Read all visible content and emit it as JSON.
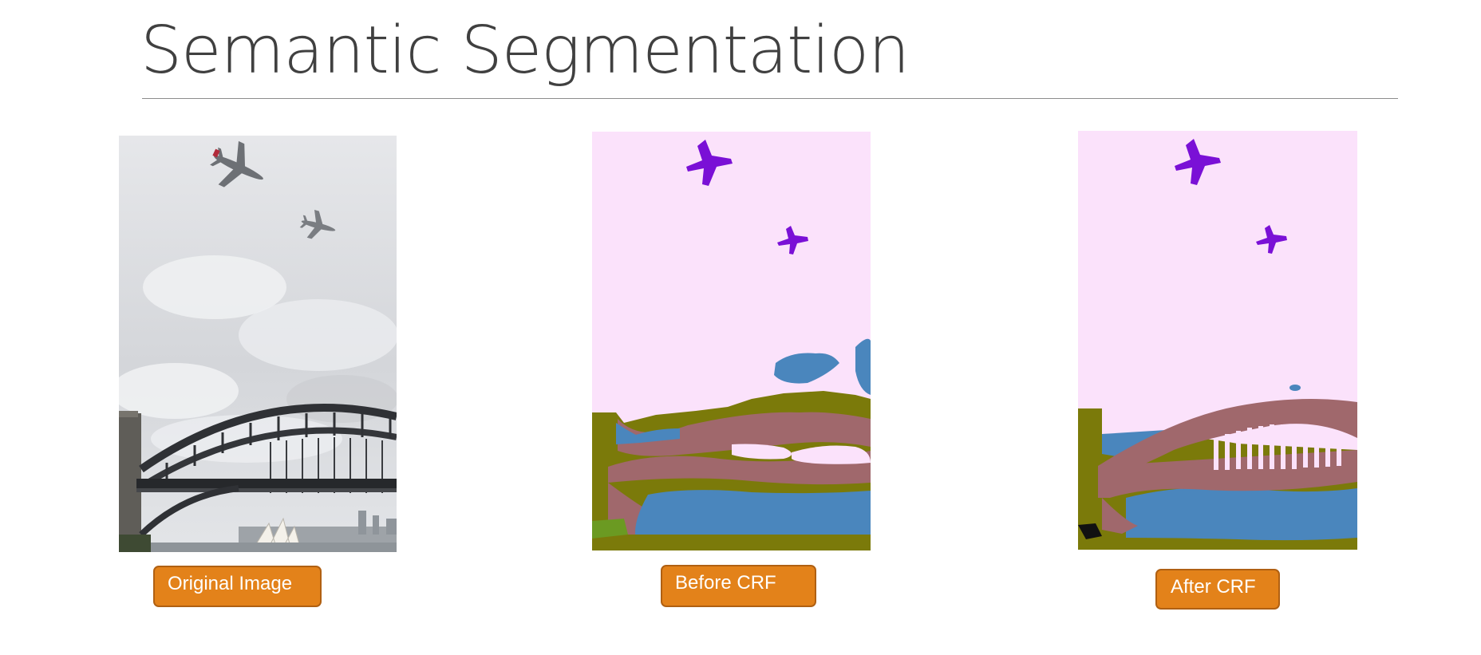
{
  "slide": {
    "title": "Semantic Segmentation"
  },
  "panels": [
    {
      "caption": "Original Image",
      "image": "sydney-harbour-bridge-with-two-airplanes-photo"
    },
    {
      "caption": "Before CRF",
      "image": "segmentation-mask-before-crf"
    },
    {
      "caption": "After CRF",
      "image": "segmentation-mask-after-crf"
    }
  ],
  "colors": {
    "title_text": "#404040",
    "rule": "#8c8c8c",
    "button_fill": "#e3821a",
    "button_border": "#b06012",
    "button_text": "#ffffff",
    "mask_sky": "#fbe2fb",
    "mask_airplane": "#7a10d6",
    "mask_bridge": "#a0686c",
    "mask_water": "#4a86bd",
    "mask_terrain": "#7b7a0a",
    "mask_vegetation": "#6b9a22",
    "mask_unlabeled": "#111111"
  }
}
